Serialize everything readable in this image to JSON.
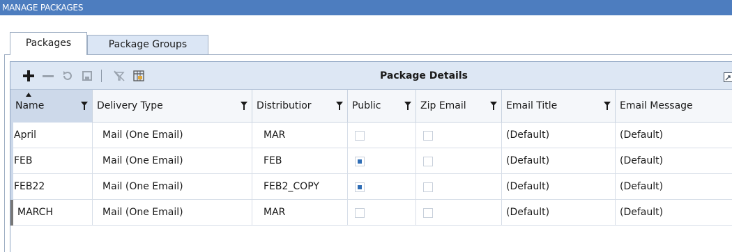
{
  "window": {
    "title": "MANAGE PACKAGES"
  },
  "tabs": [
    {
      "label": "Packages",
      "active": true
    },
    {
      "label": "Package Groups",
      "active": false
    }
  ],
  "toolbar": {
    "title": "Package Details",
    "icons": [
      "add-icon",
      "remove-icon",
      "refresh-icon",
      "save-icon",
      "clear-filter-icon",
      "column-chooser-icon",
      "expand-icon"
    ]
  },
  "grid": {
    "columns": [
      "Name",
      "Delivery Type",
      "Distributior",
      "Public",
      "Zip Email",
      "Email Title",
      "Email Message"
    ],
    "rows": [
      {
        "name": "April",
        "delivery_type": "Mail (One Email)",
        "distribution": "MAR",
        "public": false,
        "zip_email": false,
        "email_title": "(Default)",
        "email_message": "(Default)"
      },
      {
        "name": "FEB",
        "delivery_type": "Mail (One Email)",
        "distribution": "FEB",
        "public": true,
        "zip_email": false,
        "email_title": "(Default)",
        "email_message": "(Default)"
      },
      {
        "name": "FEB22",
        "delivery_type": "Mail (One Email)",
        "distribution": "FEB2_COPY",
        "public": true,
        "zip_email": false,
        "email_title": "(Default)",
        "email_message": "(Default)"
      },
      {
        "name": "MARCH",
        "delivery_type": "Mail (One Email)",
        "distribution": "MAR",
        "public": false,
        "zip_email": false,
        "email_title": "(Default)",
        "email_message": "(Default)"
      }
    ]
  },
  "colors": {
    "titlebar": "#4d7dbf",
    "toolbar": "#dde7f4",
    "checkbox_fill": "#2f6db5"
  }
}
